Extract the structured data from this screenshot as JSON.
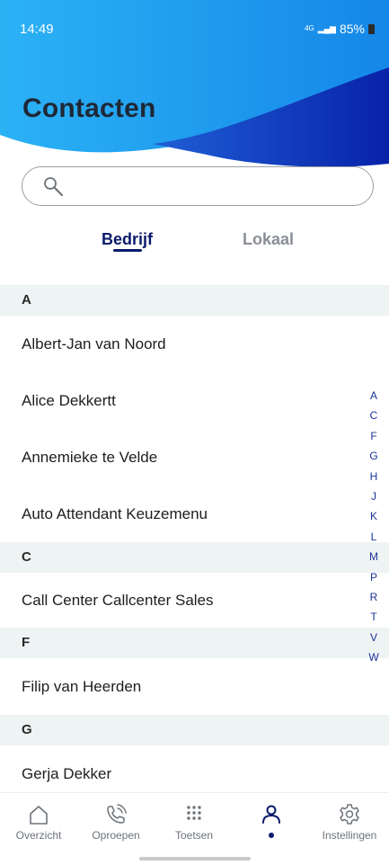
{
  "status": {
    "time": "14:49",
    "network": "4G",
    "signal": "▂▄▆",
    "battery": "85%"
  },
  "title": "Contacten",
  "search": {
    "value": "",
    "placeholder": ""
  },
  "tabs": [
    {
      "label": "Bedrijf",
      "active": true
    },
    {
      "label": "Lokaal",
      "active": false
    }
  ],
  "sections": [
    {
      "letter": "A",
      "contacts": [
        "Albert-Jan van Noord",
        "Alice Dekkertt",
        "Annemieke te Velde",
        "Auto Attendant Keuzemenu"
      ]
    },
    {
      "letter": "C",
      "contacts": [
        "Call Center Callcenter Sales"
      ]
    },
    {
      "letter": "F",
      "contacts": [
        "Filip van Heerden"
      ]
    },
    {
      "letter": "G",
      "contacts": [
        "Gerja Dekker"
      ]
    }
  ],
  "alphabet_index": [
    "A",
    "C",
    "F",
    "G",
    "H",
    "J",
    "K",
    "L",
    "M",
    "P",
    "R",
    "T",
    "V",
    "W"
  ],
  "bottom_nav": [
    {
      "label": "Overzicht",
      "icon": "home-icon"
    },
    {
      "label": "Oproepen",
      "icon": "phone-icon"
    },
    {
      "label": "Toetsen",
      "icon": "keypad-icon"
    },
    {
      "label": "",
      "icon": "person-icon",
      "active": true
    },
    {
      "label": "Instellingen",
      "icon": "gear-icon"
    }
  ],
  "colors": {
    "header_light": "#1fa8f0",
    "header_dark": "#0a2fb8",
    "accent": "#0a1a6b",
    "section_bg": "#eef3f4"
  }
}
